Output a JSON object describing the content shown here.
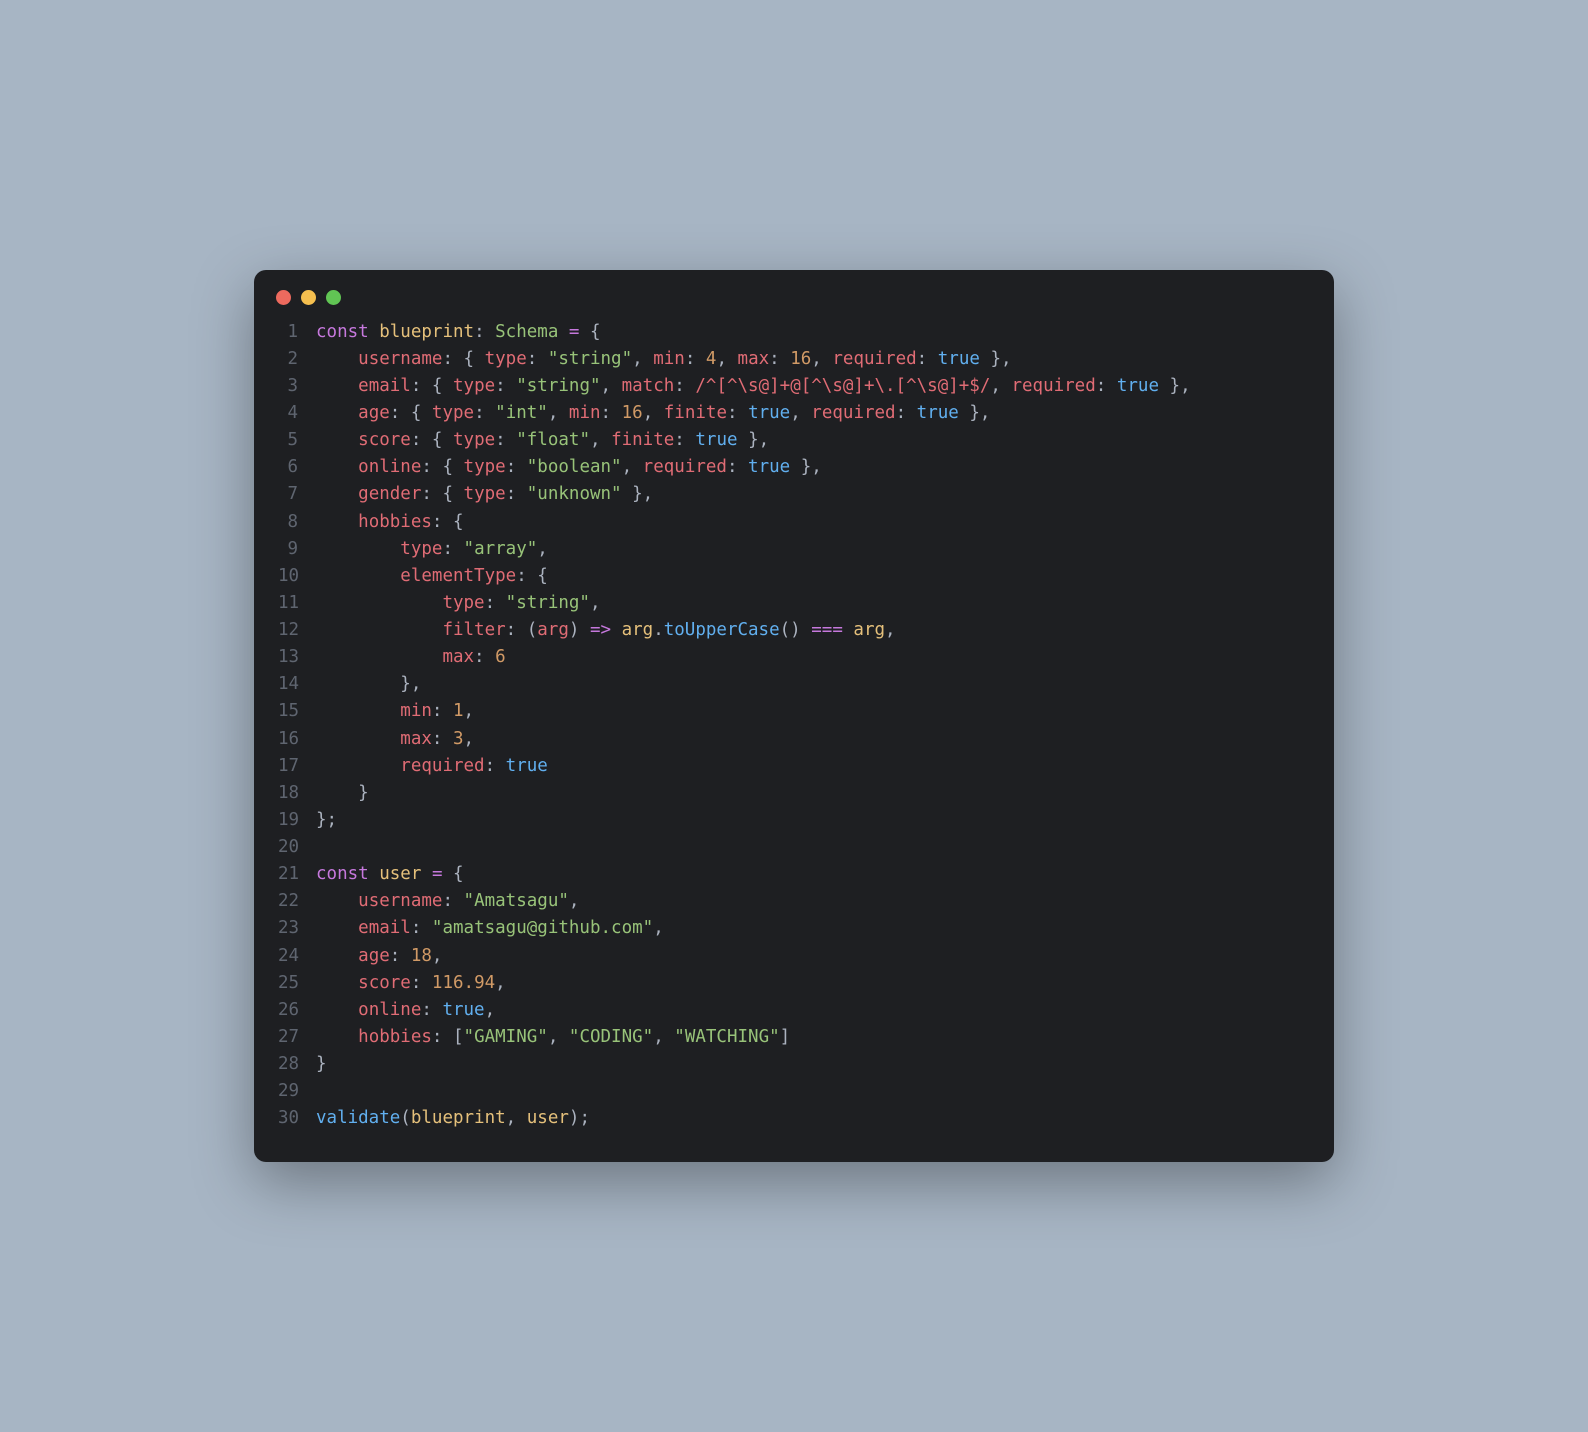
{
  "window": {
    "traffic_lights": [
      "close",
      "minimize",
      "zoom"
    ]
  },
  "code": {
    "language": "typescript",
    "lines": [
      {
        "n": 1,
        "tokens": [
          [
            "kw",
            "const"
          ],
          [
            "punc",
            " "
          ],
          [
            "var",
            "blueprint"
          ],
          [
            "punc",
            ": "
          ],
          [
            "type",
            "Schema"
          ],
          [
            "punc",
            " "
          ],
          [
            "op",
            "="
          ],
          [
            "punc",
            " {"
          ]
        ]
      },
      {
        "n": 2,
        "tokens": [
          [
            "punc",
            "    "
          ],
          [
            "key2",
            "username"
          ],
          [
            "punc",
            ": { "
          ],
          [
            "key2",
            "type"
          ],
          [
            "punc",
            ": "
          ],
          [
            "str",
            "\"string\""
          ],
          [
            "punc",
            ", "
          ],
          [
            "key2",
            "min"
          ],
          [
            "punc",
            ": "
          ],
          [
            "num",
            "4"
          ],
          [
            "punc",
            ", "
          ],
          [
            "key2",
            "max"
          ],
          [
            "punc",
            ": "
          ],
          [
            "num",
            "16"
          ],
          [
            "punc",
            ", "
          ],
          [
            "key2",
            "required"
          ],
          [
            "punc",
            ": "
          ],
          [
            "bool",
            "true"
          ],
          [
            "punc",
            " },"
          ]
        ]
      },
      {
        "n": 3,
        "tokens": [
          [
            "punc",
            "    "
          ],
          [
            "key2",
            "email"
          ],
          [
            "punc",
            ": { "
          ],
          [
            "key2",
            "type"
          ],
          [
            "punc",
            ": "
          ],
          [
            "str",
            "\"string\""
          ],
          [
            "punc",
            ", "
          ],
          [
            "key2",
            "match"
          ],
          [
            "punc",
            ": "
          ],
          [
            "regex",
            "/^[^\\s@]+@[^\\s@]+\\.[^\\s@]+$/"
          ],
          [
            "punc",
            ", "
          ],
          [
            "key2",
            "required"
          ],
          [
            "punc",
            ": "
          ],
          [
            "bool",
            "true"
          ],
          [
            "punc",
            " },"
          ]
        ]
      },
      {
        "n": 4,
        "tokens": [
          [
            "punc",
            "    "
          ],
          [
            "key2",
            "age"
          ],
          [
            "punc",
            ": { "
          ],
          [
            "key2",
            "type"
          ],
          [
            "punc",
            ": "
          ],
          [
            "str",
            "\"int\""
          ],
          [
            "punc",
            ", "
          ],
          [
            "key2",
            "min"
          ],
          [
            "punc",
            ": "
          ],
          [
            "num",
            "16"
          ],
          [
            "punc",
            ", "
          ],
          [
            "key2",
            "finite"
          ],
          [
            "punc",
            ": "
          ],
          [
            "bool",
            "true"
          ],
          [
            "punc",
            ", "
          ],
          [
            "key2",
            "required"
          ],
          [
            "punc",
            ": "
          ],
          [
            "bool",
            "true"
          ],
          [
            "punc",
            " },"
          ]
        ]
      },
      {
        "n": 5,
        "tokens": [
          [
            "punc",
            "    "
          ],
          [
            "key2",
            "score"
          ],
          [
            "punc",
            ": { "
          ],
          [
            "key2",
            "type"
          ],
          [
            "punc",
            ": "
          ],
          [
            "str",
            "\"float\""
          ],
          [
            "punc",
            ", "
          ],
          [
            "key2",
            "finite"
          ],
          [
            "punc",
            ": "
          ],
          [
            "bool",
            "true"
          ],
          [
            "punc",
            " },"
          ]
        ]
      },
      {
        "n": 6,
        "tokens": [
          [
            "punc",
            "    "
          ],
          [
            "key2",
            "online"
          ],
          [
            "punc",
            ": { "
          ],
          [
            "key2",
            "type"
          ],
          [
            "punc",
            ": "
          ],
          [
            "str",
            "\"boolean\""
          ],
          [
            "punc",
            ", "
          ],
          [
            "key2",
            "required"
          ],
          [
            "punc",
            ": "
          ],
          [
            "bool",
            "true"
          ],
          [
            "punc",
            " },"
          ]
        ]
      },
      {
        "n": 7,
        "tokens": [
          [
            "punc",
            "    "
          ],
          [
            "key2",
            "gender"
          ],
          [
            "punc",
            ": { "
          ],
          [
            "key2",
            "type"
          ],
          [
            "punc",
            ": "
          ],
          [
            "str",
            "\"unknown\""
          ],
          [
            "punc",
            " },"
          ]
        ]
      },
      {
        "n": 8,
        "tokens": [
          [
            "punc",
            "    "
          ],
          [
            "key2",
            "hobbies"
          ],
          [
            "punc",
            ": {"
          ]
        ]
      },
      {
        "n": 9,
        "tokens": [
          [
            "punc",
            "        "
          ],
          [
            "key2",
            "type"
          ],
          [
            "punc",
            ": "
          ],
          [
            "str",
            "\"array\""
          ],
          [
            "punc",
            ","
          ]
        ]
      },
      {
        "n": 10,
        "tokens": [
          [
            "punc",
            "        "
          ],
          [
            "key2",
            "elementType"
          ],
          [
            "punc",
            ": {"
          ]
        ]
      },
      {
        "n": 11,
        "tokens": [
          [
            "punc",
            "            "
          ],
          [
            "key2",
            "type"
          ],
          [
            "punc",
            ": "
          ],
          [
            "str",
            "\"string\""
          ],
          [
            "punc",
            ","
          ]
        ]
      },
      {
        "n": 12,
        "tokens": [
          [
            "punc",
            "            "
          ],
          [
            "key2",
            "filter"
          ],
          [
            "punc",
            ": ("
          ],
          [
            "param",
            "arg"
          ],
          [
            "punc",
            ") "
          ],
          [
            "op",
            "=>"
          ],
          [
            "punc",
            " "
          ],
          [
            "var",
            "arg"
          ],
          [
            "punc",
            "."
          ],
          [
            "fn",
            "toUpperCase"
          ],
          [
            "punc",
            "() "
          ],
          [
            "op",
            "==="
          ],
          [
            "punc",
            " "
          ],
          [
            "var",
            "arg"
          ],
          [
            "punc",
            ","
          ]
        ]
      },
      {
        "n": 13,
        "tokens": [
          [
            "punc",
            "            "
          ],
          [
            "key2",
            "max"
          ],
          [
            "punc",
            ": "
          ],
          [
            "num",
            "6"
          ]
        ]
      },
      {
        "n": 14,
        "tokens": [
          [
            "punc",
            "        },"
          ]
        ]
      },
      {
        "n": 15,
        "tokens": [
          [
            "punc",
            "        "
          ],
          [
            "key2",
            "min"
          ],
          [
            "punc",
            ": "
          ],
          [
            "num",
            "1"
          ],
          [
            "punc",
            ","
          ]
        ]
      },
      {
        "n": 16,
        "tokens": [
          [
            "punc",
            "        "
          ],
          [
            "key2",
            "max"
          ],
          [
            "punc",
            ": "
          ],
          [
            "num",
            "3"
          ],
          [
            "punc",
            ","
          ]
        ]
      },
      {
        "n": 17,
        "tokens": [
          [
            "punc",
            "        "
          ],
          [
            "key2",
            "required"
          ],
          [
            "punc",
            ": "
          ],
          [
            "bool",
            "true"
          ]
        ]
      },
      {
        "n": 18,
        "tokens": [
          [
            "punc",
            "    }"
          ]
        ]
      },
      {
        "n": 19,
        "tokens": [
          [
            "punc",
            "};"
          ]
        ]
      },
      {
        "n": 20,
        "tokens": [
          [
            "punc",
            ""
          ]
        ]
      },
      {
        "n": 21,
        "tokens": [
          [
            "kw",
            "const"
          ],
          [
            "punc",
            " "
          ],
          [
            "var",
            "user"
          ],
          [
            "punc",
            " "
          ],
          [
            "op",
            "="
          ],
          [
            "punc",
            " {"
          ]
        ]
      },
      {
        "n": 22,
        "tokens": [
          [
            "punc",
            "    "
          ],
          [
            "key2",
            "username"
          ],
          [
            "punc",
            ": "
          ],
          [
            "str",
            "\"Amatsagu\""
          ],
          [
            "punc",
            ","
          ]
        ]
      },
      {
        "n": 23,
        "tokens": [
          [
            "punc",
            "    "
          ],
          [
            "key2",
            "email"
          ],
          [
            "punc",
            ": "
          ],
          [
            "str",
            "\"amatsagu@github.com\""
          ],
          [
            "punc",
            ","
          ]
        ]
      },
      {
        "n": 24,
        "tokens": [
          [
            "punc",
            "    "
          ],
          [
            "key2",
            "age"
          ],
          [
            "punc",
            ": "
          ],
          [
            "num",
            "18"
          ],
          [
            "punc",
            ","
          ]
        ]
      },
      {
        "n": 25,
        "tokens": [
          [
            "punc",
            "    "
          ],
          [
            "key2",
            "score"
          ],
          [
            "punc",
            ": "
          ],
          [
            "num",
            "116.94"
          ],
          [
            "punc",
            ","
          ]
        ]
      },
      {
        "n": 26,
        "tokens": [
          [
            "punc",
            "    "
          ],
          [
            "key2",
            "online"
          ],
          [
            "punc",
            ": "
          ],
          [
            "bool",
            "true"
          ],
          [
            "punc",
            ","
          ]
        ]
      },
      {
        "n": 27,
        "tokens": [
          [
            "punc",
            "    "
          ],
          [
            "key2",
            "hobbies"
          ],
          [
            "punc",
            ": ["
          ],
          [
            "str",
            "\"GAMING\""
          ],
          [
            "punc",
            ", "
          ],
          [
            "str",
            "\"CODING\""
          ],
          [
            "punc",
            ", "
          ],
          [
            "str",
            "\"WATCHING\""
          ],
          [
            "punc",
            "]"
          ]
        ]
      },
      {
        "n": 28,
        "tokens": [
          [
            "punc",
            "}"
          ]
        ]
      },
      {
        "n": 29,
        "tokens": [
          [
            "punc",
            ""
          ]
        ]
      },
      {
        "n": 30,
        "tokens": [
          [
            "fn",
            "validate"
          ],
          [
            "punc",
            "("
          ],
          [
            "var",
            "blueprint"
          ],
          [
            "punc",
            ", "
          ],
          [
            "var",
            "user"
          ],
          [
            "punc",
            ");"
          ]
        ]
      }
    ]
  }
}
